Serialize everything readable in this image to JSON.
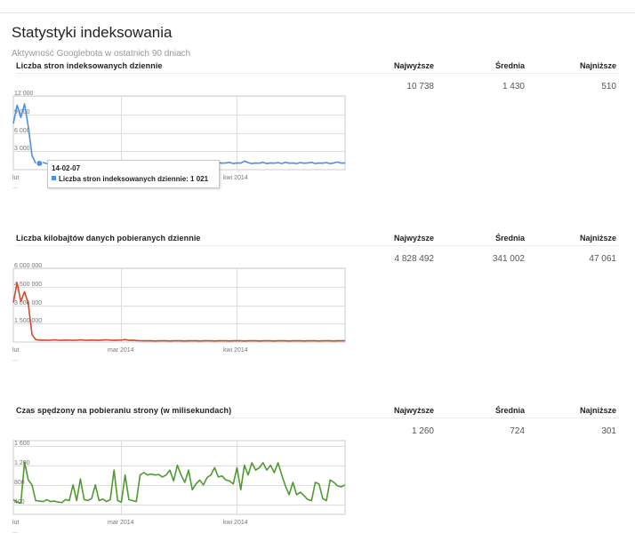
{
  "page": {
    "title": "Statystyki indeksowania",
    "subtitle": "Aktywność Googlebota w ostatnich 90 dniach"
  },
  "columns": {
    "max": "Najwyższe",
    "avg": "Średnia",
    "min": "Najniższe"
  },
  "sections": [
    {
      "title": "Liczba stron indeksowanych dziennie",
      "max": "10 738",
      "avg": "1 430",
      "min": "510",
      "ellipsis": "..."
    },
    {
      "title": "Liczba kilobajtów danych pobieranych dziennie",
      "max": "4 828 492",
      "avg": "341 002",
      "min": "47 061",
      "ellipsis": "..."
    },
    {
      "title": "Czas spędzony na pobieraniu strony (w milisekundach)",
      "max": "1 260",
      "avg": "724",
      "min": "301",
      "ellipsis": "..."
    }
  ],
  "tooltip": {
    "date": "14-02-07",
    "label": "Liczba stron indeksowanych dziennie: 1 021"
  },
  "chart_data": [
    {
      "type": "line",
      "title": "Liczba stron indeksowanych dziennie",
      "color": "#4d8fe6",
      "ylim": [
        0,
        12000
      ],
      "yticks": [
        12000,
        9000,
        6000,
        3000
      ],
      "ytick_labels": [
        "12 000",
        "9 000",
        "6 000",
        "3 000"
      ],
      "xtick_labels": [
        "lut",
        "mar 2014",
        "kwi 2014"
      ],
      "highlight_index": 7,
      "values": [
        7500,
        10500,
        8500,
        10700,
        7000,
        2300,
        1100,
        1021,
        1150,
        1000,
        1100,
        1050,
        1150,
        1000,
        1200,
        1050,
        1100,
        1000,
        1100,
        1050,
        1150,
        1000,
        1100,
        1050,
        1200,
        1000,
        1100,
        1050,
        1150,
        1000,
        1100,
        1200,
        1050,
        1100,
        1000,
        1150,
        1050,
        1100,
        1000,
        1200,
        1050,
        1100,
        1000,
        1150,
        1050,
        1100,
        1000,
        1200,
        1100,
        1050,
        1150,
        1000,
        1500,
        1100,
        1000,
        1150,
        1050,
        1100,
        1200,
        1000,
        1100,
        1050,
        1400,
        1150,
        1000,
        1100,
        1050,
        1200,
        1000,
        1100,
        1050,
        1150,
        1000,
        1200,
        1050,
        1100,
        1000,
        1150,
        1050,
        1100,
        1200,
        1000,
        1100,
        1050,
        1150,
        1000,
        1100,
        1250,
        1050,
        1100
      ]
    },
    {
      "type": "line",
      "title": "Liczba kilobajtów danych pobieranych dziennie",
      "color": "#d14b31",
      "ylim": [
        0,
        6000000
      ],
      "yticks": [
        6000000,
        4500000,
        3000000,
        1500000
      ],
      "ytick_labels": [
        "6 000 000",
        "4 500 000",
        "3 000 000",
        "1 500 000"
      ],
      "xtick_labels": [
        "lut",
        "mar 2014",
        "kwi 2014"
      ],
      "values": [
        3200000,
        4828492,
        3300000,
        4100000,
        3100000,
        600000,
        200000,
        150000,
        160000,
        140000,
        150000,
        170000,
        150000,
        140000,
        160000,
        150000,
        140000,
        150000,
        170000,
        150000,
        140000,
        160000,
        150000,
        140000,
        160000,
        180000,
        150000,
        140000,
        150000,
        160000,
        200000,
        140000,
        150000,
        120000,
        110000,
        100000,
        110000,
        100000,
        90000,
        100000,
        110000,
        100000,
        90000,
        100000,
        110000,
        100000,
        90000,
        100000,
        110000,
        100000,
        90000,
        100000,
        110000,
        100000,
        90000,
        100000,
        110000,
        100000,
        90000,
        100000,
        110000,
        100000,
        90000,
        100000,
        110000,
        100000,
        90000,
        100000,
        110000,
        100000,
        90000,
        100000,
        110000,
        100000,
        90000,
        100000,
        110000,
        100000,
        90000,
        100000,
        110000,
        100000,
        90000,
        100000,
        110000,
        100000,
        90000,
        100000,
        110000,
        100000
      ]
    },
    {
      "type": "line",
      "title": "Czas spędzony na pobieraniu strony (w milisekundach)",
      "color": "#4f9a2f",
      "ylim": [
        200,
        1700
      ],
      "yticks": [
        1600,
        1200,
        800,
        400
      ],
      "ytick_labels": [
        "1 600",
        "1 200",
        "800",
        "400"
      ],
      "xtick_labels": [
        "lut",
        "mar 2014",
        "kwi 2014"
      ],
      "values": [
        500,
        450,
        430,
        1260,
        900,
        800,
        480,
        470,
        460,
        500,
        460,
        470,
        450,
        440,
        500,
        480,
        800,
        480,
        920,
        500,
        480,
        520,
        800,
        480,
        510,
        460,
        500,
        1100,
        480,
        450,
        1000,
        500,
        480,
        460,
        1000,
        1050,
        1000,
        1020,
        1000,
        1010,
        960,
        1000,
        1100,
        880,
        1200,
        1000,
        850,
        1100,
        700,
        820,
        900,
        800,
        950,
        1000,
        1150,
        960,
        980,
        900,
        880,
        820,
        1150,
        700,
        1200,
        1000,
        1250,
        1100,
        1150,
        1250,
        1100,
        1200,
        1050,
        1250,
        1000,
        780,
        600,
        850,
        600,
        650,
        580,
        500,
        480,
        850,
        820,
        520,
        480,
        900,
        850,
        780,
        760,
        800
      ]
    }
  ]
}
